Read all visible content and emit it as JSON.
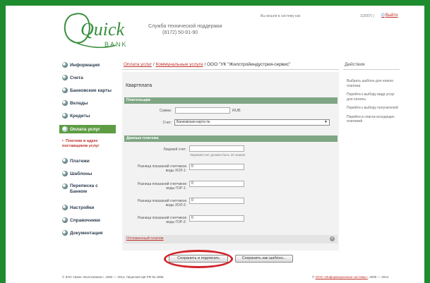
{
  "brand": {
    "logo_text": "Quick",
    "logo_subtext": "BANK",
    "support_line1": "Служба технической поддержки",
    "support_phone": "(8172) 50-91-90",
    "accent_green": "#1e8c2e",
    "link_red": "#c0312b"
  },
  "header": {
    "login_status": "Вы вошли в систему как",
    "user_id": "1(2007)",
    "separator": "|",
    "exit_label": "Выйти"
  },
  "sidebar": {
    "items": [
      {
        "label": "Информация"
      },
      {
        "label": "Счета"
      },
      {
        "label": "Банковские карты"
      },
      {
        "label": "Вклады"
      },
      {
        "label": "Кредиты"
      },
      {
        "label": "Оплата услуг"
      },
      {
        "label": "Платежи"
      },
      {
        "label": "Шаблоны"
      },
      {
        "label": "Переписка с Банком"
      },
      {
        "label": "Настройки"
      },
      {
        "label": "Справочники"
      },
      {
        "label": "Документация"
      }
    ],
    "subitem": "Платежи в адрес поставщиков услуг"
  },
  "breadcrumb": {
    "part1": "Оплата услуг",
    "part2": "Коммунальные услуги",
    "part3": "ООО \"УК \"Жилстройиндустрия-сервис\""
  },
  "actions": {
    "title": "Действия",
    "items": [
      "Выбрать шаблон для нового платежа",
      "Перейти к выбору вида услуг для оплаты",
      "Перейти к выбору получателей",
      "Перейти в список исходящих платежей"
    ]
  },
  "form": {
    "title": "Квартплата",
    "payer_section": "Плательщик",
    "sum_label": "Сумма:",
    "sum_value": "",
    "currency": "RUB",
    "account_label": "Счет:",
    "account_value": "Банковская карта №",
    "payment_section": "Данные платежа",
    "personal_account_label": "Лицевой счет:",
    "personal_account_value": "",
    "personal_account_hint": "Лицевой счет должен быть 10 знаков",
    "meters": [
      {
        "label_line1": "Разница показаний счетчиков",
        "label_line2": "воды ХОЛ-1:",
        "value": "0"
      },
      {
        "label_line1": "Разница показаний счетчиков",
        "label_line2": "воды ГОР-1:",
        "value": "0"
      },
      {
        "label_line1": "Разница показаний счетчиков",
        "label_line2": "воды ХОЛ-2:",
        "value": "0"
      },
      {
        "label_line1": "Разница показаний счетчиков",
        "label_line2": "воды ГОР-2:",
        "value": "0"
      }
    ],
    "pending_label": "Отложенный платеж",
    "pending_toggle": "»",
    "save_sign_label": "Сохранить и подписать",
    "save_template_label": "Сохранить как шаблон..."
  },
  "footer": {
    "copyright": "© ЗАО «Банк «Вологжанин», 1992 — 2014, Лицензия ЦБ РФ № 1896.",
    "developer_prefix": "©",
    "developer_link": "ООО «Информационные системы»",
    "developer_years": ", 2009 — 2014"
  }
}
